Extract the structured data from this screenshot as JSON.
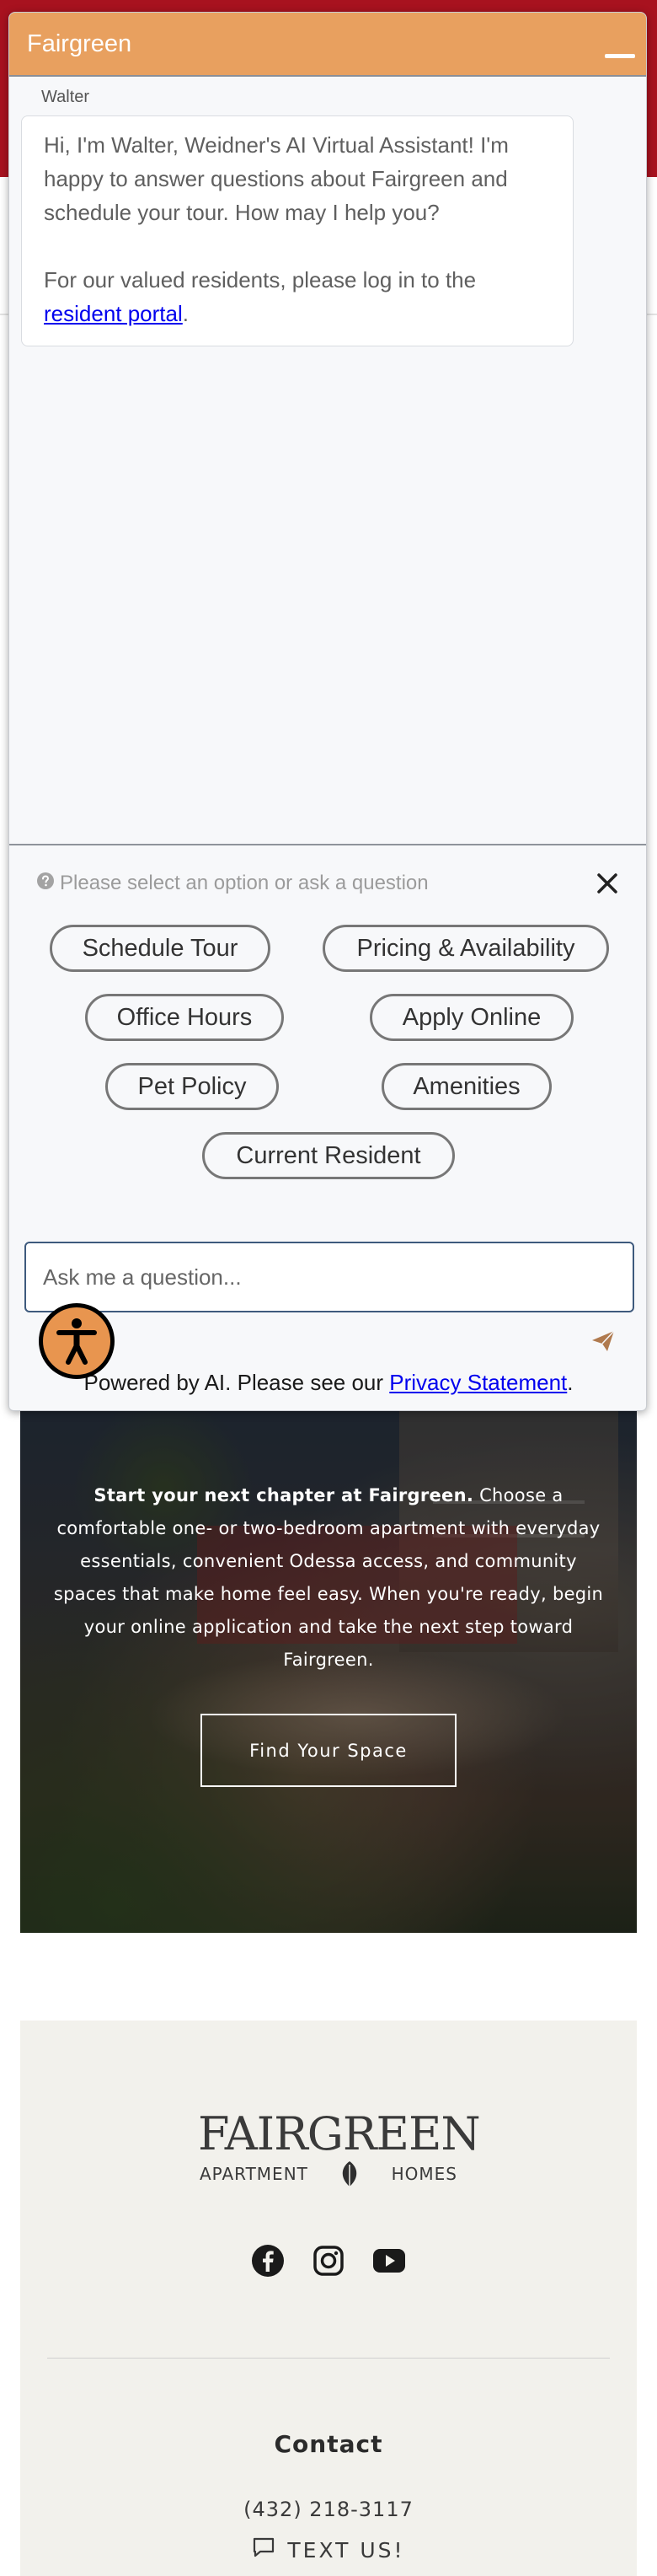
{
  "chat": {
    "title": "Fairgreen",
    "agent_name": "Walter",
    "greeting": "Hi, I'm Walter, Weidner's AI Virtual Assistant! I'm happy to answer questions about Fairgreen and schedule your tour. How may I help you?",
    "resident_prefix": "For our valued residents, please log in to the ",
    "resident_link": "resident portal",
    "resident_suffix": ".",
    "prompt_hint": "Please select an option or ask a question",
    "options": [
      "Schedule Tour",
      "Pricing & Availability",
      "Office Hours",
      "Apply Online",
      "Pet Policy",
      "Amenities",
      "Current Resident"
    ],
    "input_placeholder": "Ask me a question...",
    "powered_prefix": "Powered by AI. Please see our ",
    "privacy_link": "Privacy Statement",
    "powered_suffix": ".",
    "header_color": "#e8a05f"
  },
  "hero": {
    "lead": "Start your next chapter at Fairgreen.",
    "body": " Choose a comfortable one- or two-bedroom apartment with everyday essentials, convenient Odessa access, and community spaces that make home feel easy. When you're ready, begin your online application and take the next step toward Fairgreen.",
    "button": "Find Your Space"
  },
  "footer": {
    "logo_main": "FAIRGREEN",
    "logo_left": "APARTMENT",
    "logo_right": "HOMES",
    "social": [
      "facebook-icon",
      "instagram-icon",
      "youtube-icon"
    ],
    "contact_heading": "Contact",
    "phone": "(432) 218-3117",
    "text_us": "TEXT US!"
  },
  "colors": {
    "brand_red": "#a8121f",
    "accent_orange": "#e8a05f",
    "footer_bg": "#f2f1ec"
  }
}
